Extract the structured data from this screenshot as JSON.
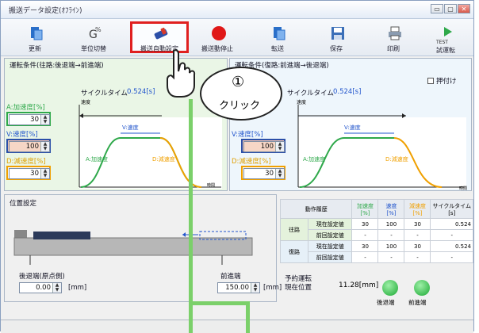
{
  "window": {
    "title": "搬送データ設定(ｵﾌﾗｲﾝ)",
    "btn_min": "▭",
    "btn_max": "▢",
    "btn_close": "✕"
  },
  "toolbar": {
    "items": [
      {
        "label": "更新",
        "icon": "update-icon"
      },
      {
        "label": "単位切替",
        "icon": "unit-switch-icon"
      },
      {
        "label": "搬送自動設定",
        "icon": "auto-setting-icon"
      },
      {
        "label": "搬送動停止",
        "icon": "stop-icon"
      },
      {
        "label": "転送",
        "icon": "transfer-icon"
      },
      {
        "label": "保存",
        "icon": "save-icon"
      },
      {
        "label": "印刷",
        "icon": "print-icon"
      },
      {
        "label": "試運転",
        "icon": "test-run-icon",
        "icon_text": "TEST"
      }
    ]
  },
  "left_panel": {
    "title": "運転条件(往路:後退端→前進端)",
    "cycle_time_label": "サイクルタイム",
    "cycle_time": "0.524[s]",
    "speed_axis": "速度",
    "time_axis": "時間",
    "accel_label": "A:加速度[%]",
    "accel_value": "30",
    "speed_label": "V:速度[%]",
    "speed_value": "100",
    "decel_label": "D:減速度[%]",
    "decel_value": "30",
    "graph_v": "V:速度",
    "graph_a": "A:加速度",
    "graph_d": "D:減速度"
  },
  "right_panel": {
    "title": "運転条件(復路:前進端→後退端)",
    "checkbox_label": "押付け",
    "cycle_time_label": "サイクルタイム",
    "cycle_time": "0.524[s]",
    "speed_axis": "速度",
    "time_axis": "時間",
    "speed_label": "V:速度[%]",
    "speed_value": "100",
    "decel_label": "D:減速度[%]",
    "decel_value": "30",
    "graph_v": "V:速度",
    "graph_a": "A:加速度",
    "graph_d": "D:減速度"
  },
  "position_panel": {
    "title": "位置設定",
    "back_label": "後退端(原点側)",
    "back_value": "0.00",
    "front_label": "前進端",
    "front_value": "150.00",
    "unit": "[mm]"
  },
  "param_table": {
    "headers": [
      "動作履歴",
      "",
      "加速度\n[%]",
      "速度\n[%]",
      "減速度\n[%]",
      "サイクルタイム\n[s]"
    ],
    "rows": [
      {
        "group": "往路",
        "label": "現在設定値",
        "accel": "30",
        "speed": "100",
        "decel": "30",
        "cycle": "0.524"
      },
      {
        "group": "",
        "label": "前回設定値",
        "accel": "-",
        "speed": "-",
        "decel": "-",
        "cycle": "-"
      },
      {
        "group": "復路",
        "label": "現在設定値",
        "accel": "30",
        "speed": "100",
        "decel": "30",
        "cycle": "0.524"
      },
      {
        "group": "",
        "label": "前回設定値",
        "accel": "-",
        "speed": "-",
        "decel": "-",
        "cycle": "-"
      }
    ]
  },
  "monitor": {
    "title": "予約運転",
    "position_label": "現在位置",
    "position_value": "11.28[mm]",
    "back_lamp": "後退端",
    "front_lamp": "前進端"
  },
  "callout": {
    "number": "①",
    "text": "クリック"
  },
  "colors": {
    "highlight": "#e02020",
    "green": "#2ea84a",
    "accent": "#2255cc"
  }
}
